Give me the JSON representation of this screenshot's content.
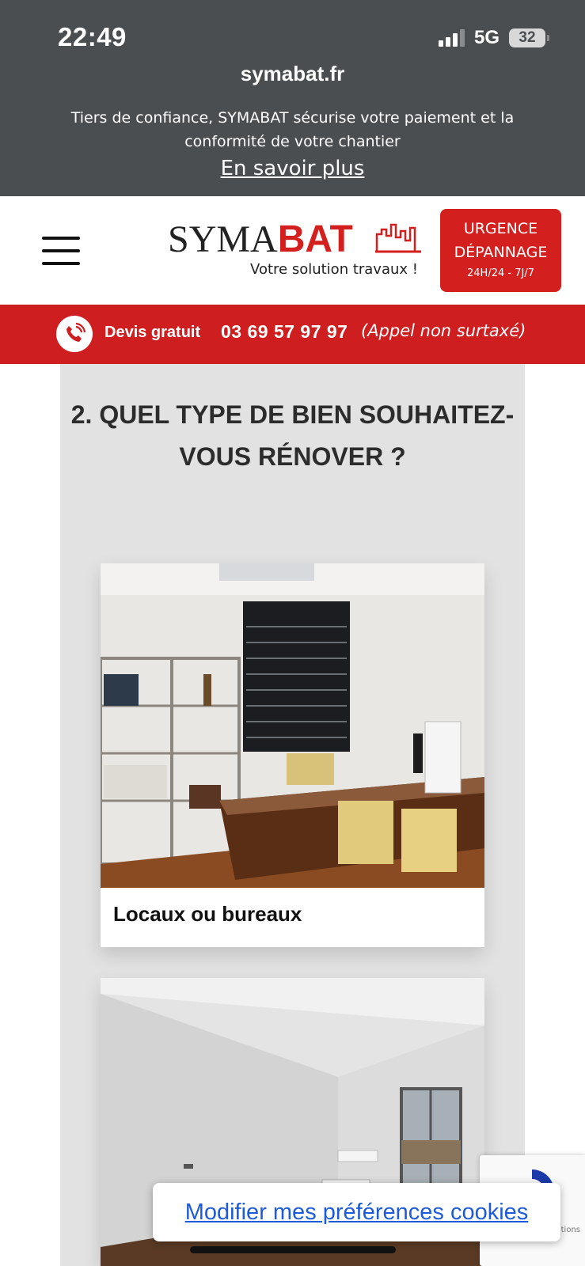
{
  "status_bar": {
    "time": "22:49",
    "network": "5G",
    "battery": "32"
  },
  "browser": {
    "domain": "symabat.fr"
  },
  "notice": {
    "text": "Tiers de confiance, SYMABAT sécurise votre paiement et la conformité de votre chantier",
    "link": "En savoir plus"
  },
  "header": {
    "logo_part1": "SYMA",
    "logo_part2": "BAT",
    "tagline": "Votre solution travaux !",
    "urgence_line1": "URGENCE",
    "urgence_line2": "DÉPANNAGE",
    "urgence_line3": "24H/24 - 7J/7"
  },
  "phone_bar": {
    "label": "Devis gratuit",
    "number": "03 69 57 97 97",
    "note": "(Appel non surtaxé)"
  },
  "question": {
    "title": "2. QUEL TYPE DE BIEN SOUHAITEZ-VOUS RÉNOVER ?"
  },
  "options": [
    {
      "label": "Locaux ou bureaux",
      "icon": "office-photo"
    },
    {
      "label": "",
      "icon": "empty-room-photo"
    }
  ],
  "overlays": {
    "cookie_button": "Modifier mes préférences cookies",
    "recaptcha_text": "itions"
  },
  "colors": {
    "brand_red": "#d3201f",
    "topbar": "#4b4e51",
    "panel": "#e2e2e2",
    "cookie_link": "#1e5bd8"
  }
}
